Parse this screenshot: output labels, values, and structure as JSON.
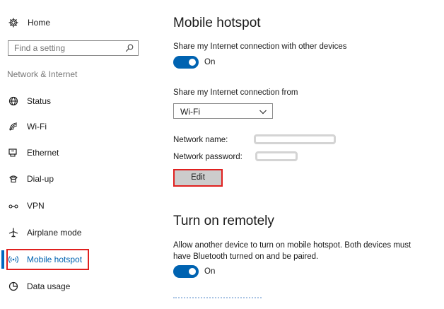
{
  "sidebar": {
    "home_label": "Home",
    "search_placeholder": "Find a setting",
    "section_label": "Network & Internet",
    "items": [
      {
        "label": "Status",
        "icon": "status-globe-icon"
      },
      {
        "label": "Wi-Fi",
        "icon": "wifi-icon"
      },
      {
        "label": "Ethernet",
        "icon": "ethernet-icon"
      },
      {
        "label": "Dial-up",
        "icon": "dialup-icon"
      },
      {
        "label": "VPN",
        "icon": "vpn-icon"
      },
      {
        "label": "Airplane mode",
        "icon": "airplane-icon"
      },
      {
        "label": "Mobile hotspot",
        "icon": "hotspot-icon",
        "active": true
      },
      {
        "label": "Data usage",
        "icon": "data-usage-icon"
      }
    ]
  },
  "main": {
    "title": "Mobile hotspot",
    "share_label": "Share my Internet connection with other devices",
    "share_toggle_state": "On",
    "share_from_label": "Share my Internet connection from",
    "share_from_value": "Wi-Fi",
    "network_name_label": "Network name:",
    "network_password_label": "Network password:",
    "edit_label": "Edit",
    "remote_title": "Turn on remotely",
    "remote_description": "Allow another device to turn on mobile hotspot. Both devices must have Bluetooth turned on and be paired.",
    "remote_toggle_state": "On"
  },
  "colors": {
    "accent": "#0063b1",
    "highlight_box": "#e0201f",
    "button_bg": "#cccccc",
    "muted_text": "#767676"
  }
}
